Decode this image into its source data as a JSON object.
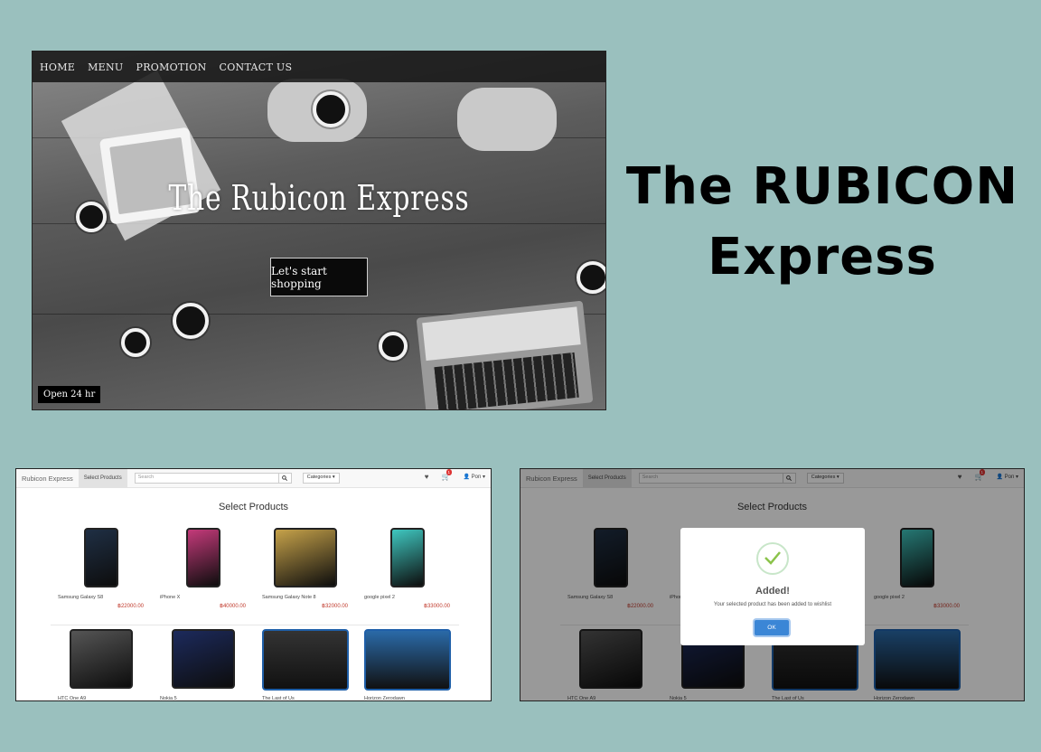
{
  "hero": {
    "nav": [
      "HOME",
      "MENU",
      "PROMOTION",
      "CONTACT US"
    ],
    "title": "The Rubicon Express",
    "cta": "Let's start shopping",
    "hours": "Open 24 hr"
  },
  "slide_title": "The RUBICON Express",
  "shop": {
    "brand": "Rubicon Express",
    "active_tab": "Select Products",
    "search_placeholder": "Search",
    "categories": "Categories ▾",
    "cart_count": "1",
    "user": "Pon ▾",
    "page_title": "Select Products",
    "products": [
      {
        "name": "Samsung Galaxy S8",
        "price": "฿22000.00",
        "color": "#1f2f44"
      },
      {
        "name": "iPhone X",
        "price": "฿40000.00",
        "color": "#c43a7a"
      },
      {
        "name": "Samsung Galaxy Note 8",
        "price": "฿32000.00",
        "color": "#c6a24a"
      },
      {
        "name": "google pixel 2",
        "price": "฿33000.00",
        "color": "#3fc7c0"
      },
      {
        "name": "HTC One A9",
        "price": "",
        "color": "#555555"
      },
      {
        "name": "Nokia 5",
        "price": "",
        "color": "#1c2a5c"
      },
      {
        "name": "The Last of Us",
        "price": "",
        "color": "#333333"
      },
      {
        "name": "Horizon Zerodawn",
        "price": "",
        "color": "#2a6aa8"
      }
    ]
  },
  "modal": {
    "title": "Added!",
    "text": "Your selected product has been added to wishlist",
    "ok": "OK"
  }
}
